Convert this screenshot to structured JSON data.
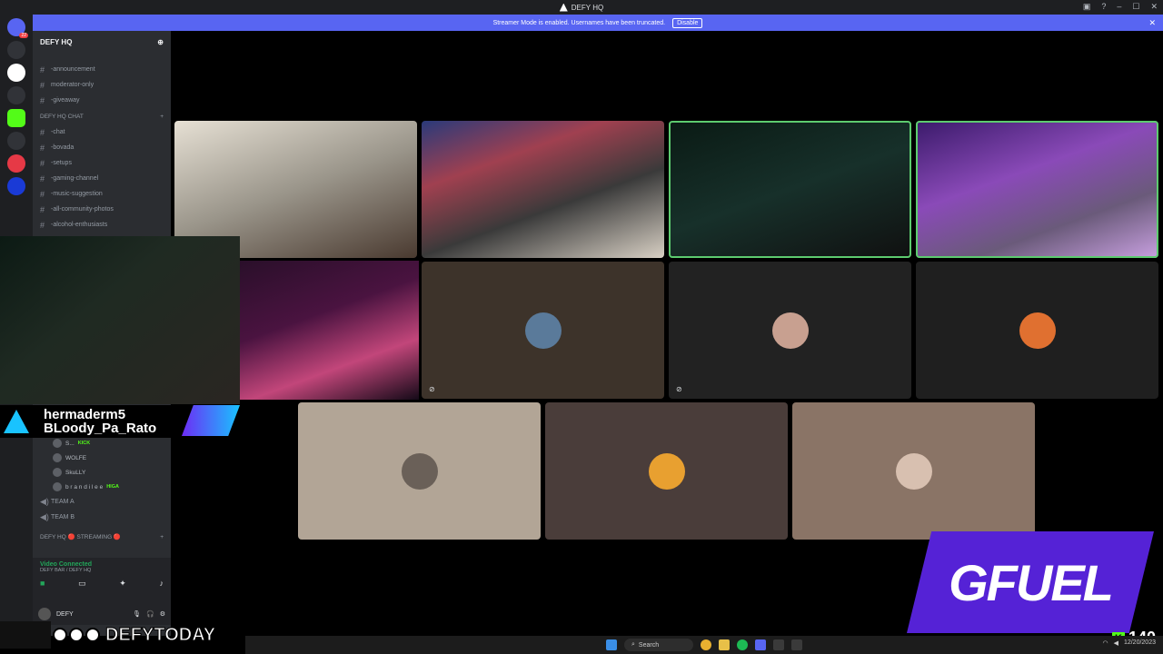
{
  "window": {
    "title": "DEFY HQ"
  },
  "banner": {
    "text": "Streamer Mode is enabled. Usernames have been truncated.",
    "button": "Disable"
  },
  "guilds": {
    "badge": "22"
  },
  "server": {
    "name": "DEFY HQ",
    "channels_top": [
      {
        "label": "-announcement"
      },
      {
        "label": "moderator-only"
      },
      {
        "label": "-giveaway"
      }
    ],
    "category_chat": "DEFY HQ CHAT",
    "channels_chat": [
      {
        "label": "-chat"
      },
      {
        "label": "-bovada"
      },
      {
        "label": "-setups"
      },
      {
        "label": "-gaming-channel"
      },
      {
        "label": "-music-suggestion"
      },
      {
        "label": "-all-community-photos"
      },
      {
        "label": "-alcohol-enthusiasts"
      }
    ],
    "voice_users": [
      {
        "name": "S...",
        "tag": "KICK"
      },
      {
        "name": "WOLFE",
        "tag": ""
      },
      {
        "name": "SkuLLY",
        "tag": ""
      },
      {
        "name": "b r a n d i l e e",
        "tag": "HIGA"
      }
    ],
    "voice_channels": [
      {
        "label": "TEAM A"
      },
      {
        "label": "TEAM B"
      }
    ],
    "category_streaming": "DEFY HQ 🔴 STREAMING 🔴"
  },
  "voice_status": {
    "title": "Video Connected",
    "subtitle": "DEFY BAR / DEFY HQ"
  },
  "user_panel": {
    "name": "DEFY"
  },
  "overlay": {
    "name1": "hermaderm5",
    "name2": "BLoody_Pa_Rato",
    "handle": "DEFYTODAY",
    "sponsor": "GFUEL",
    "viewer_count": "140"
  },
  "taskbar": {
    "search_placeholder": "Search",
    "date": "12/20/2023"
  }
}
